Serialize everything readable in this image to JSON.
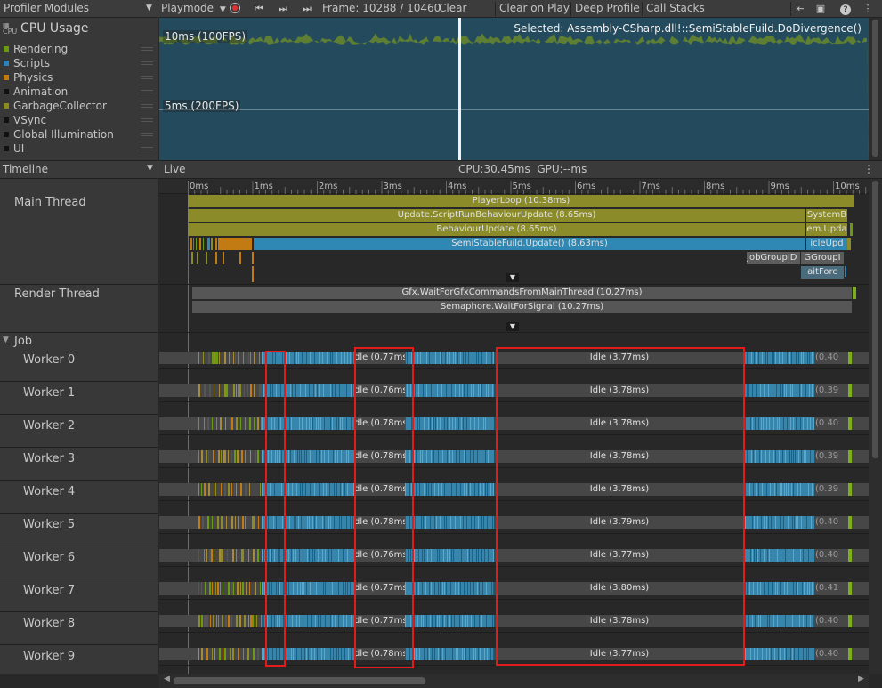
{
  "toolbar": {
    "modules_label": "Profiler Modules",
    "playmode_label": "Playmode",
    "frame_label": "Frame: 10288 / 10460",
    "clear_label": "Clear",
    "clear_on_play_label": "Clear on Play",
    "deep_profile_label": "Deep Profile",
    "call_stacks_label": "Call Stacks",
    "icons": [
      "record-icon",
      "step-first-icon",
      "step-next-icon",
      "step-last-icon",
      "load-icon",
      "save-icon",
      "help-icon",
      "menu-icon"
    ]
  },
  "cpu_module": {
    "title": "CPU Usage",
    "categories": [
      {
        "label": "Rendering",
        "color": "#6a9a14"
      },
      {
        "label": "Scripts",
        "color": "#2e82b8"
      },
      {
        "label": "Physics",
        "color": "#c27b12"
      },
      {
        "label": "Animation",
        "color": "#111111"
      },
      {
        "label": "GarbageCollector",
        "color": "#8a8a20"
      },
      {
        "label": "VSync",
        "color": "#111111"
      },
      {
        "label": "Global Illumination",
        "color": "#111111"
      },
      {
        "label": "UI",
        "color": "#111111"
      }
    ],
    "line_10ms": "10ms (100FPS)",
    "line_5ms": "5ms (200FPS)",
    "selected_text": "Selected: Assembly-CSharp.dll!::SemiStableFuild.DoDivergence()"
  },
  "timeline": {
    "view_label": "Timeline",
    "live_label": "Live",
    "cpu_gpu_label": "CPU:30.45ms  GPU:--ms",
    "ruler_ticks": [
      "0ms",
      "1ms",
      "2ms",
      "3ms",
      "4ms",
      "5ms",
      "6ms",
      "7ms",
      "8ms",
      "9ms",
      "10ms"
    ],
    "main_thread_label": "Main Thread",
    "render_thread_label": "Render Thread",
    "job_group_label": "Job",
    "main_samples": {
      "player_loop": "PlayerLoop (10.38ms)",
      "update_script": "Update.ScriptRunBehaviourUpdate (8.65ms)",
      "behaviour_update": "BehaviourUpdate (8.65ms)",
      "semistable": "SemiStableFuild.Update() (8.63ms)",
      "system_b": "SystemB",
      "em_upda": "em.Upda",
      "icle_upd": "icleUpd",
      "job_group": "JobGroupID (0",
      "g_group": "GGroupI",
      "wait_forc": "aitForc"
    },
    "render_samples": {
      "gfx_wait": "Gfx.WaitForGfxCommandsFromMainThread (10.27ms)",
      "semaphore": "Semaphore.WaitForSignal (10.27ms)"
    },
    "workers": [
      {
        "name": "Worker 0",
        "idle1": "dle (0.77ms",
        "idle2": "Idle (3.77ms)",
        "tail": "(0.40"
      },
      {
        "name": "Worker 1",
        "idle1": "dle (0.76ms",
        "idle2": "Idle (3.78ms)",
        "tail": "(0.39"
      },
      {
        "name": "Worker 2",
        "idle1": "dle (0.78ms",
        "idle2": "Idle (3.78ms)",
        "tail": "(0.40"
      },
      {
        "name": "Worker 3",
        "idle1": "dle (0.78ms",
        "idle2": "Idle (3.78ms)",
        "tail": "(0.39"
      },
      {
        "name": "Worker 4",
        "idle1": "dle (0.78ms",
        "idle2": "Idle (3.78ms)",
        "tail": "(0.39"
      },
      {
        "name": "Worker 5",
        "idle1": "dle (0.78ms)",
        "idle2": "Idle (3.79ms)",
        "tail": "(0.40"
      },
      {
        "name": "Worker 6",
        "idle1": "dle (0.76ms",
        "idle2": "Idle (3.77ms)",
        "tail": "(0.40"
      },
      {
        "name": "Worker 7",
        "idle1": "dle (0.77ms",
        "idle2": "Idle (3.80ms)",
        "tail": "(0.41"
      },
      {
        "name": "Worker 8",
        "idle1": "dle (0.77ms",
        "idle2": "Idle (3.78ms)",
        "tail": "(0.40"
      },
      {
        "name": "Worker 9",
        "idle1": "dle (0.78ms)",
        "idle2": "Idle (3.77ms)",
        "tail": "(0.40"
      }
    ]
  }
}
